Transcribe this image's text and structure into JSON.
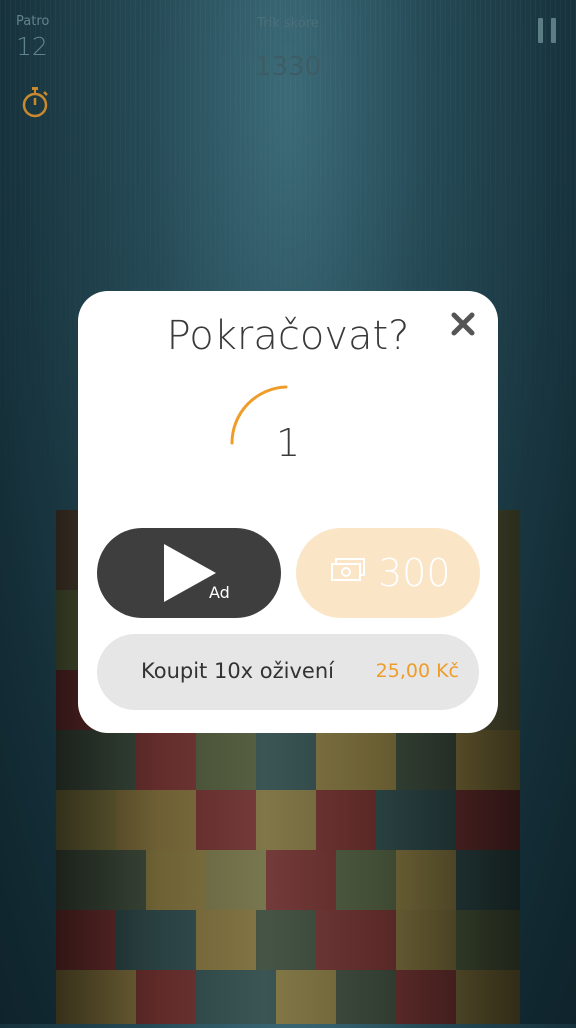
{
  "hud": {
    "floor_label": "Patro",
    "floor_value": "12",
    "score_label": "Trik skóre",
    "score_value": "1330",
    "timer_icon": "stopwatch-icon",
    "pause_icon": "pause-icon"
  },
  "dialog": {
    "title": "Pokračovat?",
    "close_icon": "close-icon",
    "countdown": "1",
    "ad_button_label": "Ad",
    "ad_icon": "play-icon",
    "buy_icon": "cash-icon",
    "buy_cost": "300",
    "buy_lives_label": "Koupit 10x oživení",
    "buy_lives_price": "25,00 Kč"
  },
  "colors": {
    "accent_orange": "#ef9d2a",
    "ad_button": "#3e3e3e",
    "buy_button": "#fae5c6",
    "background": "#254a56"
  }
}
